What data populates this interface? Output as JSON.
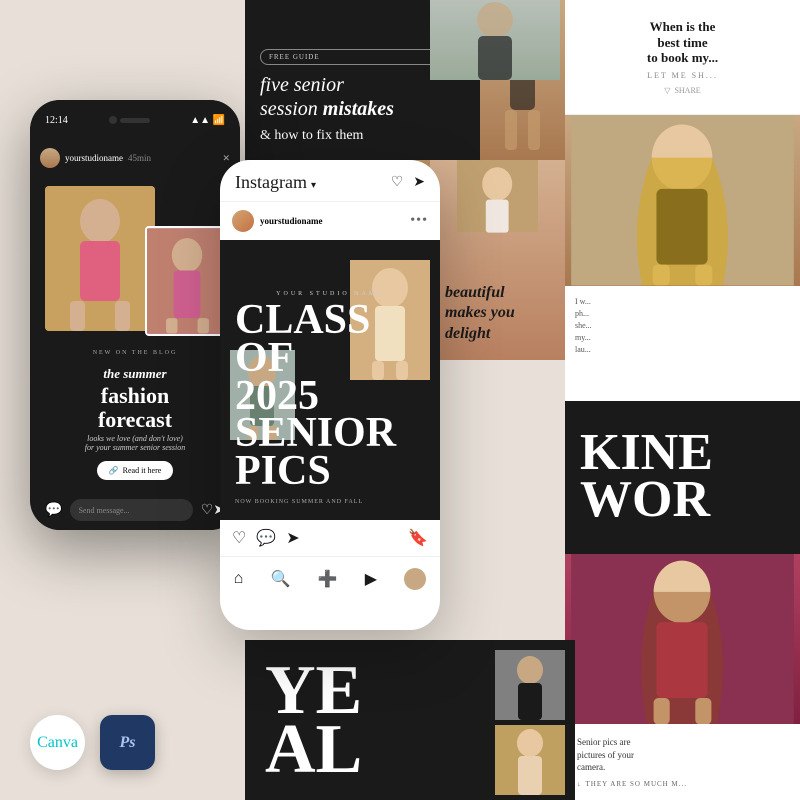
{
  "background": "#e8e0d8",
  "phoneLeft": {
    "time": "12:14",
    "username": "yourstudioname",
    "timeAgo": "45min",
    "storyLabel": "NEW ON THE BLOG",
    "titleItalic": "the summer",
    "titleBold": "fashion\nforecast",
    "subtitle": "looks we love (and don't love)\nfor your summer senior session",
    "buttonLabel": "Read it here",
    "sendMessage": "Send message..."
  },
  "phoneCenter": {
    "logoText": "Instagram",
    "username": "yourstudioname",
    "studioLabel": "YOUR STUDIO NAME",
    "classText": "CLASS OF\n2025\nSENIOR\nPICS",
    "bookingText": "NOW BOOKING\nSUMMER AND FALL"
  },
  "topDark": {
    "badgeText": "FREE GUIDE",
    "titlePart1": "five senior",
    "titlePart2": "session",
    "titleItalic": "mistakes",
    "titlePart3": "& how to fix them"
  },
  "rightPanels": {
    "whenTitle": "When is the\nbest time\nto book my...",
    "whenSub": "LET ME SHOW",
    "shareLabel": "SHARE",
    "kindText": "KIND\nWOR",
    "beautifulText": "beautiful\nmakes you\ndelight",
    "seniorDesc": "Senior pics are\npictures of your\ncamera.",
    "seniorCta": "THEY ARE SO MUCH M..."
  },
  "bottomText": "YE\nAL",
  "toolBadges": {
    "canva": "Canva",
    "ps": "Ps"
  }
}
